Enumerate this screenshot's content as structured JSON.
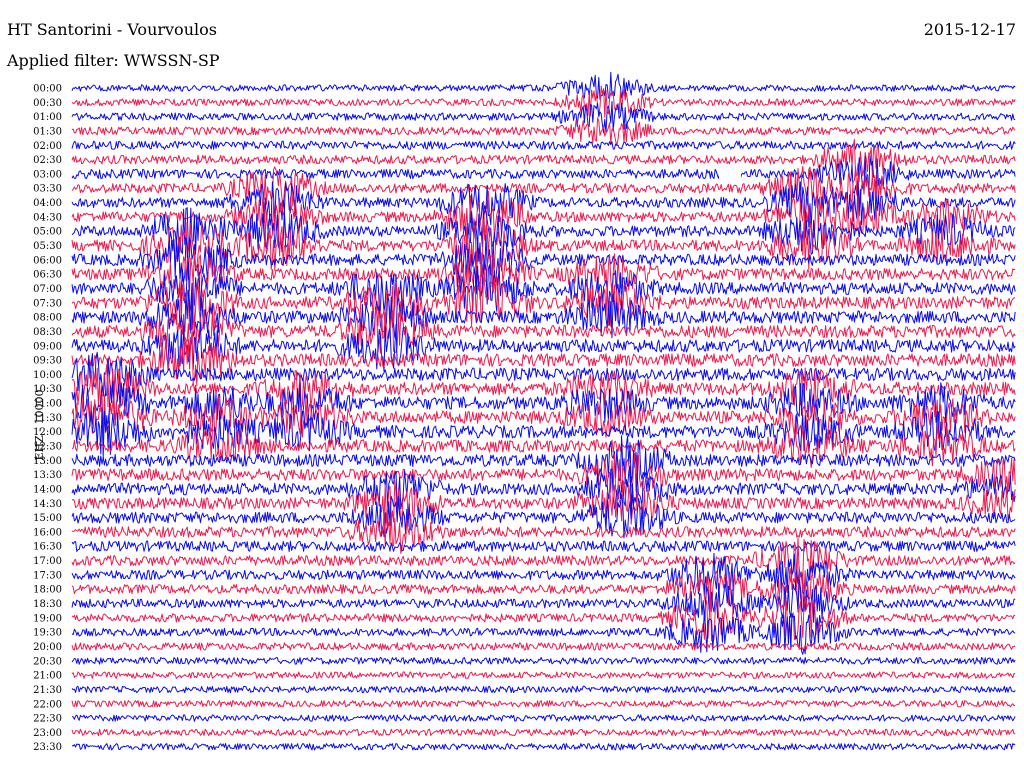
{
  "header": {
    "station": "HT Santorini - Vourvoulos",
    "date": "2015-12-17",
    "filter": "Applied filter: WWSSN-SP"
  },
  "channel_label": "EHZ - 10000",
  "colors": {
    "trace_blue": "#0b0bea",
    "trace_red": "#ee1b4f",
    "background": "#ffffff"
  },
  "chart_data": {
    "type": "helicorder",
    "line_labels": [
      "00:00",
      "00:30",
      "01:00",
      "01:30",
      "02:00",
      "02:30",
      "03:00",
      "03:30",
      "04:00",
      "04:30",
      "05:00",
      "05:30",
      "06:00",
      "06:30",
      "07:00",
      "07:30",
      "08:00",
      "08:30",
      "09:00",
      "09:30",
      "10:00",
      "10:30",
      "11:00",
      "11:30",
      "12:00",
      "12:30",
      "13:00",
      "13:30",
      "14:00",
      "14:30",
      "15:00",
      "16:00",
      "16:30",
      "17:00",
      "17:30",
      "18:00",
      "18:30",
      "19:00",
      "19:30",
      "20:00",
      "20:30",
      "21:00",
      "21:30",
      "22:00",
      "22:30",
      "23:00",
      "23:30"
    ],
    "line_duration_min": 30,
    "color_cycle": [
      "blue",
      "red"
    ],
    "legend": "none"
  }
}
